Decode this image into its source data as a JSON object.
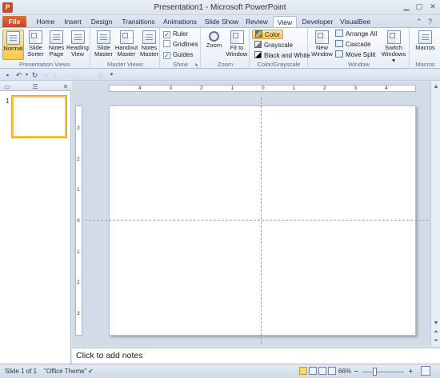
{
  "window": {
    "title": "Presentation1 - Microsoft PowerPoint",
    "app_icon_letter": "P"
  },
  "tabs": {
    "file": "File",
    "items": [
      "Home",
      "Insert",
      "Design",
      "Transitions",
      "Animations",
      "Slide Show",
      "Review",
      "View",
      "Developer",
      "VisualBee"
    ],
    "active": "View"
  },
  "ribbon": {
    "presentation_views": {
      "label": "Presentation Views",
      "buttons": [
        {
          "label1": "Normal",
          "label2": "",
          "selected": true
        },
        {
          "label1": "Slide",
          "label2": "Sorter"
        },
        {
          "label1": "Notes",
          "label2": "Page"
        },
        {
          "label1": "Reading",
          "label2": "View"
        }
      ]
    },
    "master_views": {
      "label": "Master Views",
      "buttons": [
        {
          "label1": "Slide",
          "label2": "Master"
        },
        {
          "label1": "Handout",
          "label2": "Master"
        },
        {
          "label1": "Notes",
          "label2": "Master"
        }
      ]
    },
    "show": {
      "label": "Show",
      "checks": [
        {
          "label": "Ruler",
          "checked": true
        },
        {
          "label": "Gridlines",
          "checked": false
        },
        {
          "label": "Guides",
          "checked": true
        }
      ]
    },
    "zoom": {
      "label": "Zoom",
      "buttons": [
        {
          "label1": "Zoom",
          "label2": ""
        },
        {
          "label1": "Fit to",
          "label2": "Window"
        }
      ]
    },
    "color_grayscale": {
      "label": "Color/Grayscale",
      "items": [
        {
          "label": "Color",
          "swatch": "#f2b12e",
          "selected": true
        },
        {
          "label": "Grayscale",
          "swatch": "#808080"
        },
        {
          "label": "Black and White",
          "swatch": "#000000"
        }
      ]
    },
    "window": {
      "label": "Window",
      "new_window1": "New",
      "new_window2": "Window",
      "items": [
        "Arrange All",
        "Cascade",
        "Move Split"
      ],
      "switch1": "Switch",
      "switch2": "Windows ▾"
    },
    "macros": {
      "label": "Macros",
      "button": "Macros"
    }
  },
  "left_pane": {
    "slide_number": "1"
  },
  "rulers": {
    "horizontal": [
      "4",
      "3",
      "2",
      "1",
      "0",
      "1",
      "2",
      "3",
      "4"
    ],
    "vertical": [
      "3",
      "2",
      "1",
      "0",
      "1",
      "2",
      "3"
    ]
  },
  "notes": {
    "placeholder": "Click to add notes"
  },
  "status": {
    "slide_info": "Slide 1 of 1",
    "theme": "\"Office Theme\"",
    "zoom": "66%"
  }
}
